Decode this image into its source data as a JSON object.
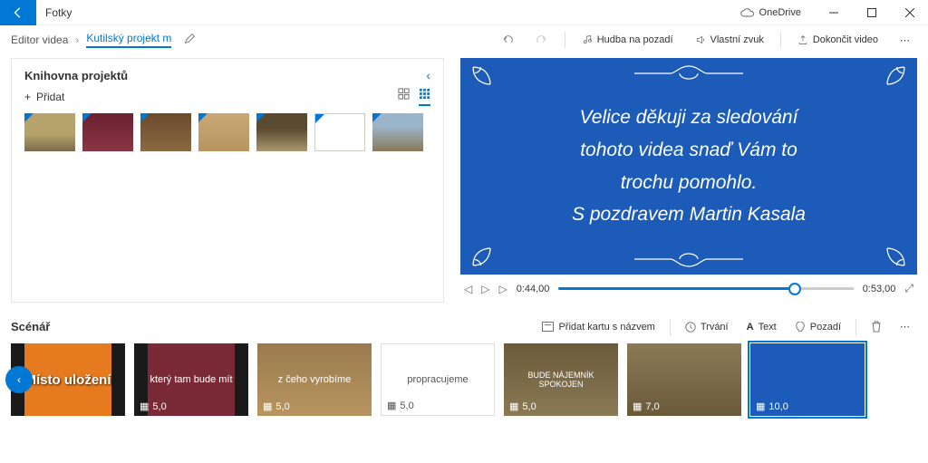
{
  "app": {
    "title": "Fotky",
    "onedrive": "OneDrive"
  },
  "breadcrumb": {
    "item1": "Editor videa",
    "item2": "Kutilský projekt m"
  },
  "toolbar": {
    "music": "Hudba na pozadí",
    "sound": "Vlastní zvuk",
    "finish": "Dokončit video"
  },
  "library": {
    "title": "Knihovna projektů",
    "add": "Přidat"
  },
  "preview": {
    "line1": "Velice děkuji za sledování",
    "line2": "tohoto videa snaď Vám to",
    "line3": "trochu pomohlo.",
    "line4": "S pozdravem Martin Kasala",
    "current_time": "0:44,00",
    "total_time": "0:53,00"
  },
  "storyboard": {
    "title": "Scénář",
    "add_card": "Přidat kartu s názvem",
    "duration": "Trvání",
    "text": "Text",
    "background": "Pozadí",
    "clips": [
      {
        "label": "Místo uložení",
        "dur": ""
      },
      {
        "label": "který tam bude mít",
        "dur": "5,0"
      },
      {
        "label": "z čeho vyrobíme",
        "dur": "5,0"
      },
      {
        "label": "propracujeme",
        "dur": "5,0"
      },
      {
        "label": "BUDE NÁJEMNÍK SPOKOJEN",
        "dur": "5,0"
      },
      {
        "label": "",
        "dur": "7,0"
      },
      {
        "label": "",
        "dur": "10,0"
      }
    ]
  }
}
